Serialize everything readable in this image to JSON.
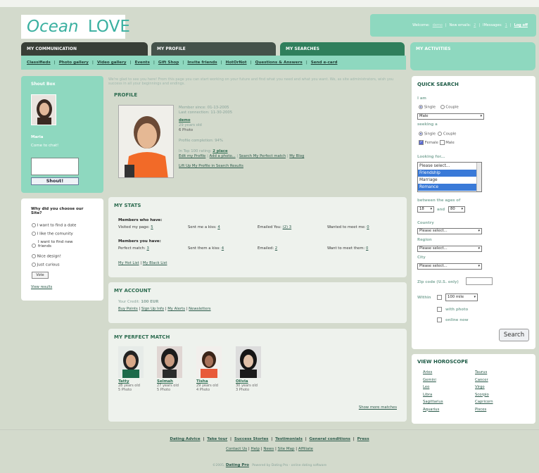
{
  "logo": {
    "part1": "Ocean",
    "part2": "LOVE"
  },
  "welcome": {
    "welcome_label": "Welcome:",
    "user": "demo",
    "emails_label": "New emails:",
    "emails_count": "2",
    "messages_label": "IMessages:",
    "messages_count": "1",
    "logout": "Log off"
  },
  "tabs": [
    "MY COMMUNICATION",
    "MY PROFILE",
    "MY SEARCHES",
    "MY ACTIVITIES"
  ],
  "subnav": [
    "Classifieds",
    "Photo gallery",
    "Video gallery",
    "Events",
    "Gift Shop",
    "Invite friends",
    "HotOrNot",
    "Questions & Answers",
    "Send e-card"
  ],
  "shoutbox": {
    "title": "Shout Box",
    "name": "Maria",
    "msg": "Come to chat!",
    "button": "Shout!"
  },
  "poll": {
    "question": "Why did you choose our Site?",
    "options": [
      "I want to find a date",
      "I like the comunity",
      "I want to find new friends",
      "Nice design!",
      "Just curious"
    ],
    "vote": "Vote",
    "results": "View results"
  },
  "greeting": "We're glad to see you here! From this page you can start working on your future and find what you need and what you want. We, as site administrators, wish you success in all your beginnings and endings.",
  "profile": {
    "title": "PROFILE",
    "member_since": "Member since: 01-13-2005",
    "last_conn": "Last connection: 11-30-2005",
    "username": "demo",
    "age": "29 years old",
    "photos": "6 Photo",
    "completion": "Profile completion: 94%",
    "top_label": "In Top 100 rating:",
    "top_link": "2 place",
    "links": [
      "Edit my Profile",
      "Add a photo...",
      "Search My Perfect match",
      "My Blog"
    ],
    "liftup": "Lift Up My Profile in Search Results"
  },
  "stats": {
    "title": "MY STATS",
    "have_title": "Members who have:",
    "have": [
      {
        "l": "Visited my page:",
        "v": "5"
      },
      {
        "l": "Sent me a kiss:",
        "v": "4"
      },
      {
        "l": "Emailed You:",
        "v": "(2) 3"
      },
      {
        "l": "Wanted to meet me:",
        "v": "0"
      }
    ],
    "you_title": "Members you have:",
    "you": [
      {
        "l": "Perfect match:",
        "v": "3"
      },
      {
        "l": "Sent them a kiss:",
        "v": "4"
      },
      {
        "l": "Emailed:",
        "v": "2"
      },
      {
        "l": "Want to meet them:",
        "v": "0"
      }
    ],
    "links": [
      "My Hot List",
      "My Black List"
    ]
  },
  "account": {
    "title": "MY ACCOUNT",
    "credit_label": "Your Credit:",
    "credit": "100 EUR",
    "links": [
      "Buy Points",
      "Sign Up Info",
      "My Alerts",
      "Newsletters"
    ]
  },
  "match": {
    "title": "MY PERFECT MATCH",
    "people": [
      {
        "name": "Tatty",
        "age": "28 years old",
        "photos": "5 Photo"
      },
      {
        "name": "Selmah",
        "age": "27 years old",
        "photos": "5 Photo"
      },
      {
        "name": "Tisha",
        "age": "29 years old",
        "photos": "4 Photo"
      },
      {
        "name": "Olivia",
        "age": "30 years old",
        "photos": "3 Photo"
      }
    ],
    "more": "Show more matches"
  },
  "quick": {
    "title": "QUICK SEARCH",
    "i_am": "I am",
    "single": "Single",
    "couple": "Couple",
    "gender": "Male",
    "seeking": "seeking a",
    "female": "Female",
    "male": "Male",
    "looking": "Looking for...",
    "looking_opts": [
      "Please select...",
      "Friendship",
      "Marriage",
      "Romance"
    ],
    "ages_label": "between the ages of",
    "age_from": "18",
    "and": "and",
    "age_to": "80",
    "country": "Country",
    "region": "Region",
    "city": "City",
    "please": "Please select...",
    "zip": "Zip code (U.S. only)",
    "within": "Within",
    "distance": "100 mile",
    "with_photo": "with photo",
    "online": "online now",
    "search": "Search"
  },
  "horoscope": {
    "title": "VIEW HOROSCOPE",
    "left": [
      "Aries",
      "Gemini",
      "Leo",
      "Libra",
      "Sagittarius",
      "Aquarius"
    ],
    "right": [
      "Taurus",
      "Cancer",
      "Virgo",
      "Scorpio",
      "Capricorn",
      "Pisces"
    ]
  },
  "footer": {
    "row1": [
      "Dating Advice",
      "Take tour",
      "Success Stories",
      "Testimonials",
      "General conditions",
      "Press"
    ],
    "row2": [
      "Contact Us",
      "Help",
      "News",
      "Site Map",
      "Affiliate"
    ],
    "copyright": "©2005,",
    "brand": "Dating Pro",
    "powered": "Powered by Dating Pro - online dating software"
  },
  "colors": {
    "accent": "#8ed8bf",
    "dark_tab": "#383f37",
    "title_green": "#2c6b4f",
    "bg": "#d3dacc"
  }
}
